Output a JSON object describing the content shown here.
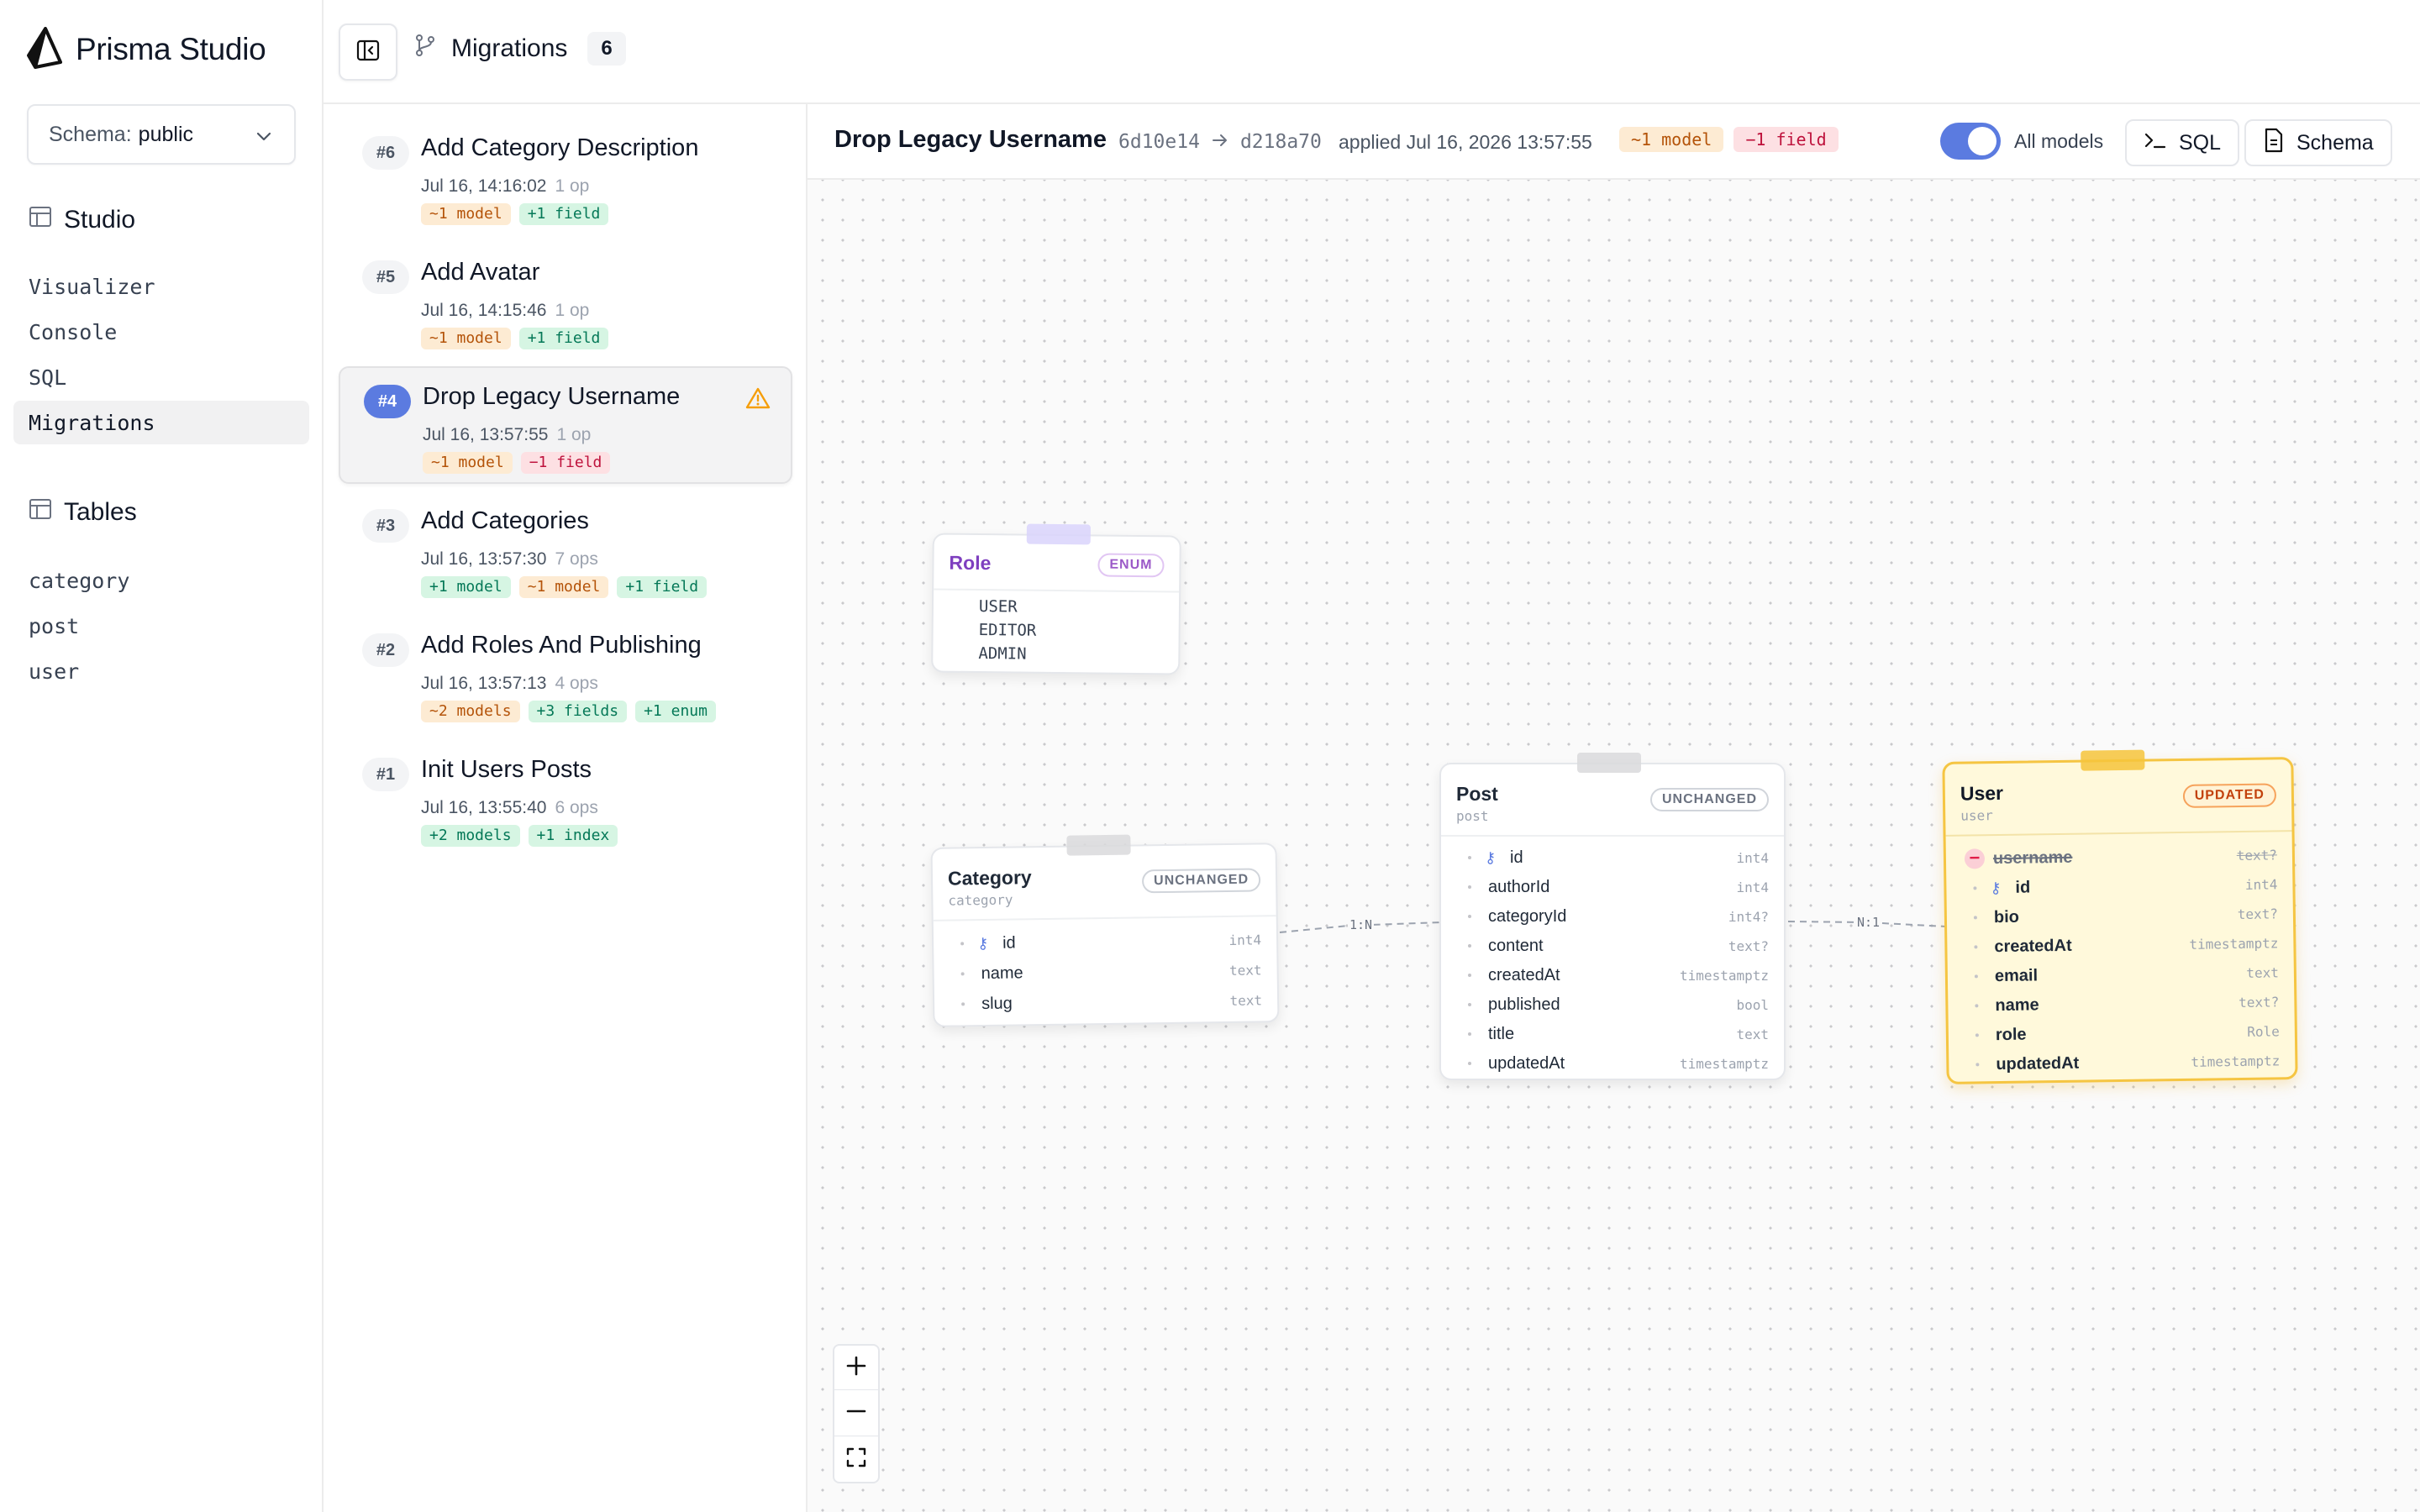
{
  "app": {
    "title": "Prisma Studio"
  },
  "schema": {
    "label": "Schema:",
    "value": "public"
  },
  "sidebar": {
    "studio_heading": "Studio",
    "studio_items": [
      "Visualizer",
      "Console",
      "SQL",
      "Migrations"
    ],
    "active_item": "Migrations",
    "tables_heading": "Tables",
    "tables": [
      "category",
      "post",
      "user"
    ]
  },
  "topbar": {
    "title": "Migrations",
    "count": "6"
  },
  "migrations": [
    {
      "num": "#6",
      "title": "Add Category Description",
      "time": "Jul 16, 14:16:02",
      "ops": "1 op",
      "tags": [
        {
          "text": "~1 model",
          "color": "orange"
        },
        {
          "text": "+1 field",
          "color": "green"
        }
      ]
    },
    {
      "num": "#5",
      "title": "Add Avatar",
      "time": "Jul 16, 14:15:46",
      "ops": "1 op",
      "tags": [
        {
          "text": "~1 model",
          "color": "orange"
        },
        {
          "text": "+1 field",
          "color": "green"
        }
      ]
    },
    {
      "num": "#4",
      "title": "Drop Legacy Username",
      "time": "Jul 16, 13:57:55",
      "ops": "1 op",
      "tags": [
        {
          "text": "~1 model",
          "color": "orange"
        },
        {
          "text": "−1 field",
          "color": "red"
        }
      ],
      "selected": true,
      "warning": true
    },
    {
      "num": "#3",
      "title": "Add Categories",
      "time": "Jul 16, 13:57:30",
      "ops": "7 ops",
      "tags": [
        {
          "text": "+1 model",
          "color": "green"
        },
        {
          "text": "~1 model",
          "color": "orange"
        },
        {
          "text": "+1 field",
          "color": "green"
        }
      ]
    },
    {
      "num": "#2",
      "title": "Add Roles And Publishing",
      "time": "Jul 16, 13:57:13",
      "ops": "4 ops",
      "tags": [
        {
          "text": "~2 models",
          "color": "orange"
        },
        {
          "text": "+3 fields",
          "color": "green"
        },
        {
          "text": "+1 enum",
          "color": "green"
        }
      ]
    },
    {
      "num": "#1",
      "title": "Init Users Posts",
      "time": "Jul 16, 13:55:40",
      "ops": "6 ops",
      "tags": [
        {
          "text": "+2 models",
          "color": "green"
        },
        {
          "text": "+1 index",
          "color": "green"
        }
      ]
    }
  ],
  "detail": {
    "title": "Drop Legacy Username",
    "from_hash": "6d10e14",
    "to_hash": "d218a70",
    "applied": "applied Jul 16, 2026 13:57:55",
    "tags": [
      {
        "text": "~1 model",
        "color": "orange"
      },
      {
        "text": "−1 field",
        "color": "red"
      }
    ],
    "toggle_label": "All models",
    "toggle_on": true,
    "sql_button": "SQL",
    "schema_button": "Schema"
  },
  "models": {
    "role": {
      "title": "Role",
      "badge": "ENUM",
      "values": [
        "USER",
        "EDITOR",
        "ADMIN"
      ]
    },
    "category": {
      "title": "Category",
      "table": "category",
      "badge": "UNCHANGED",
      "fields": [
        {
          "name": "id",
          "type": "int4",
          "key": true
        },
        {
          "name": "name",
          "type": "text"
        },
        {
          "name": "slug",
          "type": "text"
        }
      ]
    },
    "post": {
      "title": "Post",
      "table": "post",
      "badge": "UNCHANGED",
      "fields": [
        {
          "name": "id",
          "type": "int4",
          "key": true
        },
        {
          "name": "authorId",
          "type": "int4"
        },
        {
          "name": "categoryId",
          "type": "int4?"
        },
        {
          "name": "content",
          "type": "text?"
        },
        {
          "name": "createdAt",
          "type": "timestamptz"
        },
        {
          "name": "published",
          "type": "bool"
        },
        {
          "name": "title",
          "type": "text"
        },
        {
          "name": "updatedAt",
          "type": "timestamptz"
        }
      ]
    },
    "user": {
      "title": "User",
      "table": "user",
      "badge": "UPDATED",
      "fields": [
        {
          "name": "username",
          "type": "text?",
          "removed": true
        },
        {
          "name": "id",
          "type": "int4",
          "key": true
        },
        {
          "name": "bio",
          "type": "text?"
        },
        {
          "name": "createdAt",
          "type": "timestamptz"
        },
        {
          "name": "email",
          "type": "text"
        },
        {
          "name": "name",
          "type": "text?"
        },
        {
          "name": "role",
          "type": "Role"
        },
        {
          "name": "updatedAt",
          "type": "timestamptz"
        }
      ]
    }
  },
  "relations": {
    "category_post": "1:N",
    "post_user": "N:1"
  },
  "colors": {
    "accent": "#5b7be0",
    "updated": "#f5c542",
    "enum": "#7e3fbf"
  }
}
